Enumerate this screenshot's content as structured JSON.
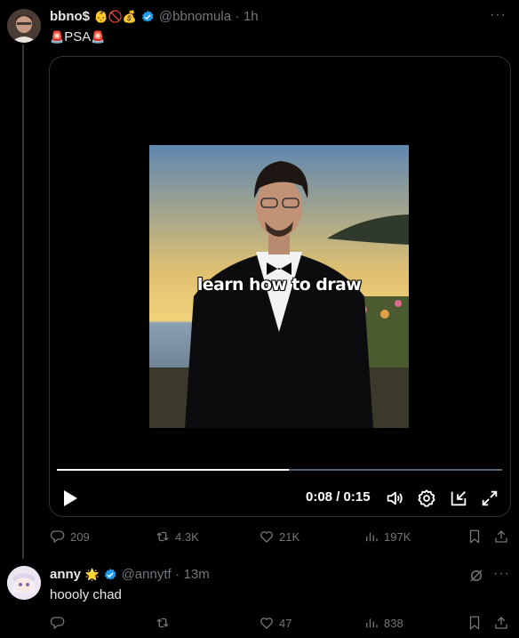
{
  "post": {
    "display_name": "bbno$",
    "name_emojis": [
      "👶",
      "🚫",
      "💰"
    ],
    "handle": "@bbnomula",
    "time": "1h",
    "text_emoji": "🚨",
    "text": "PSA",
    "video": {
      "caption": "learn how to draw",
      "current_time": "0:08",
      "duration": "0:15",
      "time_separator": " / ",
      "progress_fraction": 0.52
    },
    "stats": {
      "replies": "209",
      "reposts": "4.3K",
      "likes": "21K",
      "views": "197K"
    }
  },
  "reply": {
    "display_name": "anny",
    "name_emoji": "🌟",
    "handle": "@annytf",
    "time": "13m",
    "text": "hoooly chad",
    "stats": {
      "likes": "47",
      "views": "838"
    }
  },
  "colors": {
    "background": "#000000",
    "text": "#e7e9ea",
    "muted": "#71767b",
    "verified": "#1d9bf0",
    "border": "#2f3336"
  }
}
